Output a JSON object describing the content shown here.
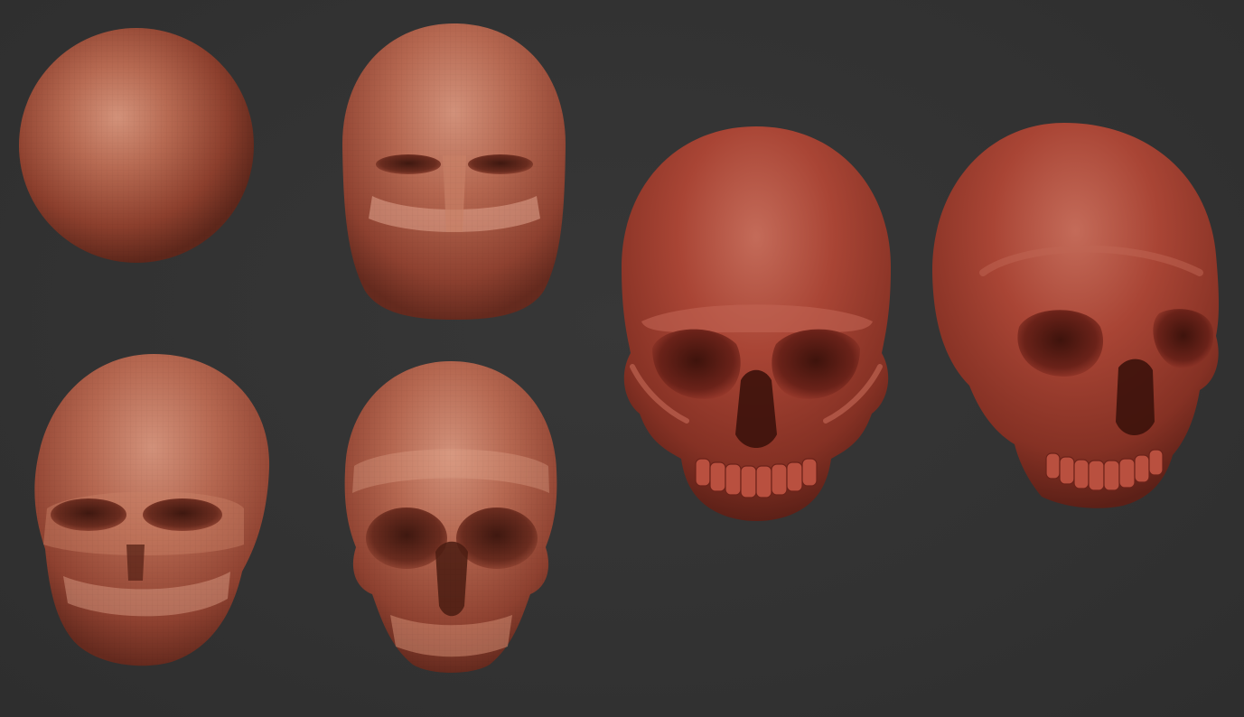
{
  "scene": {
    "background_color": "#333333",
    "clay_base_color": "#a5503d",
    "clay_light_color": "#d58a72",
    "clay_dark_color": "#5a2419",
    "clay_red_color": "#a94231"
  },
  "stages": [
    {
      "id": "sphere",
      "description_visible": false
    },
    {
      "id": "blockout"
    },
    {
      "id": "primary-forms"
    },
    {
      "id": "refined-forms"
    },
    {
      "id": "final-front"
    },
    {
      "id": "final-angle"
    }
  ]
}
